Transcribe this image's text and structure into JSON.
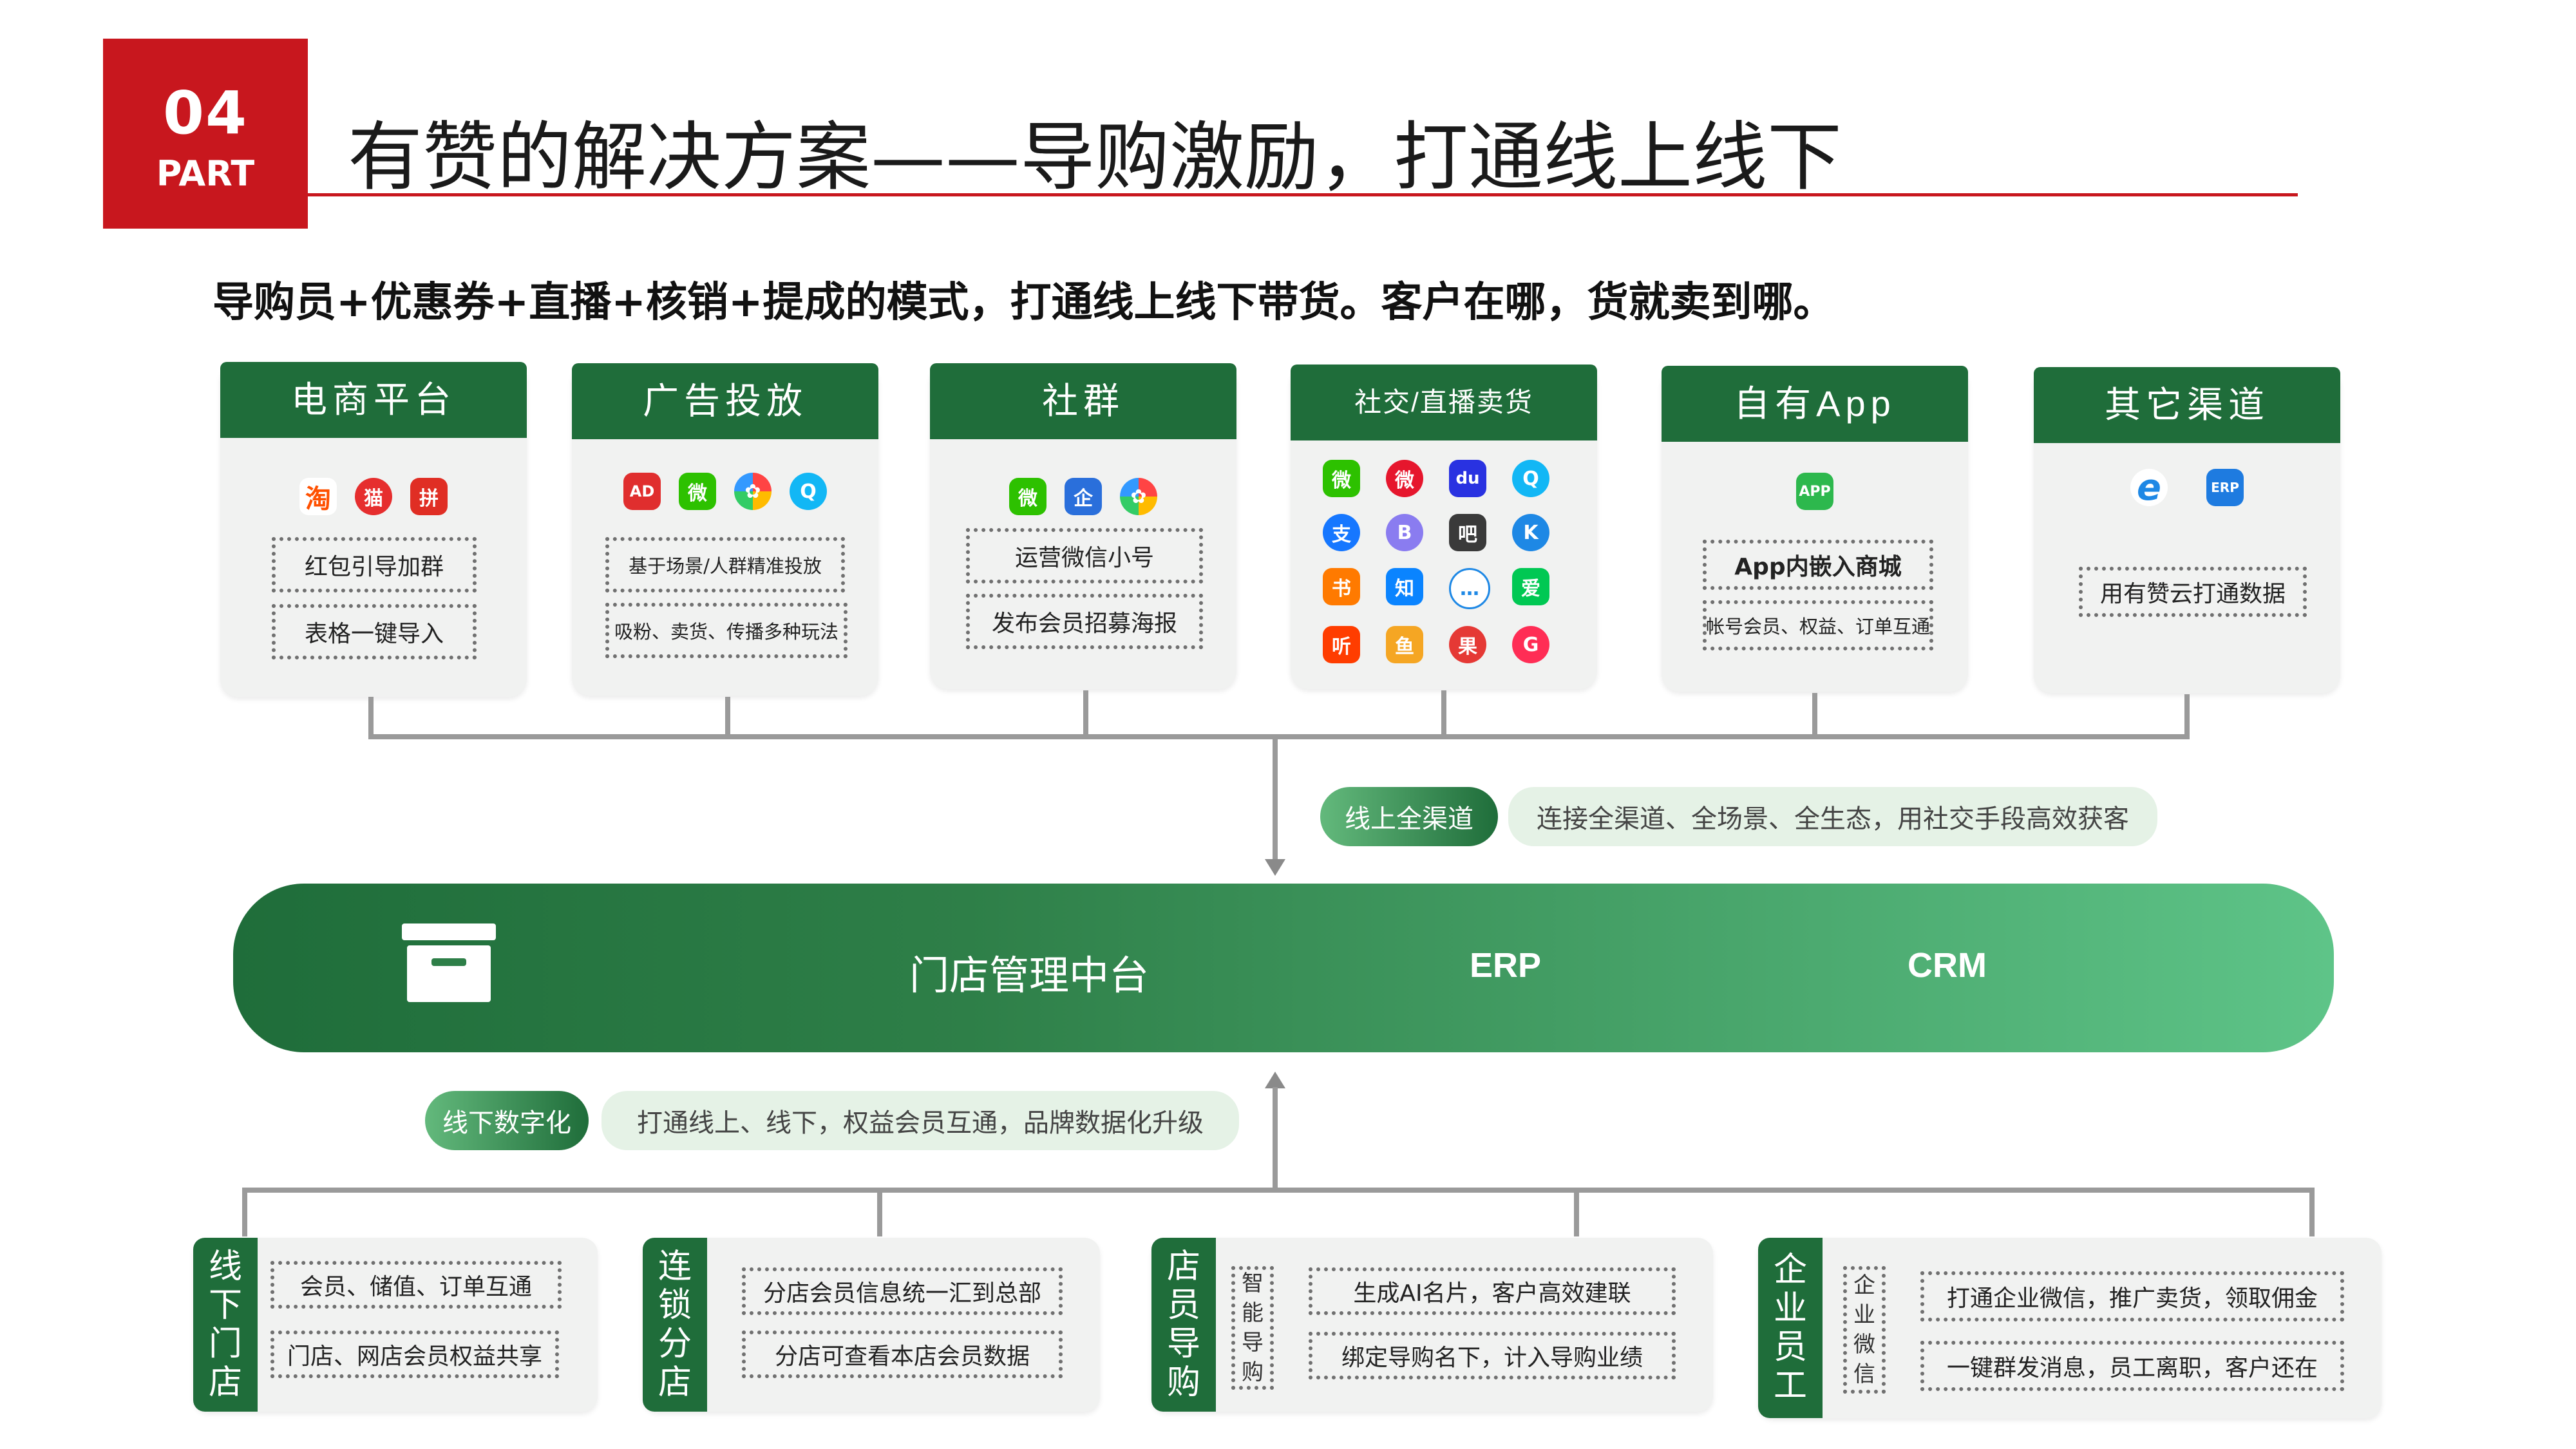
{
  "header": {
    "part_number": "04",
    "part_word": "PART",
    "title": "有赞的解决方案——导购激励，打通线上线下",
    "subtitle": "导购员+优惠券+直播+核销+提成的模式，打通线上线下带货。客户在哪，货就卖到哪。"
  },
  "channels": [
    {
      "title": "电商平台",
      "icons": [
        "taobao-icon",
        "tmall-icon",
        "pinduoduo-icon"
      ],
      "boxes": [
        "红包引导加群",
        "表格一键导入"
      ]
    },
    {
      "title": "广告投放",
      "icons": [
        "ad-icon",
        "wechat-icon",
        "photo-wheel-icon",
        "qq-icon"
      ],
      "boxes": [
        "基于场景/人群精准投放",
        "吸粉、卖货、传播多种玩法"
      ]
    },
    {
      "title": "社群",
      "icons": [
        "wechat-icon",
        "wecom-icon",
        "photo-wheel-icon"
      ],
      "boxes": [
        "运营微信小号",
        "发布会员招募海报"
      ]
    },
    {
      "title": "社交/直播卖货",
      "icons": [
        "wechat-icon",
        "weibo-icon",
        "baidu-icon",
        "qq-icon",
        "alipay-icon",
        "bilibili-icon",
        "tieba-icon",
        "kuaishou-icon",
        "xiaohongshu-icon",
        "zhihu-icon",
        "comment-icon",
        "iqiyi-icon",
        "ting-icon",
        "douyu-icon",
        "fruit-icon",
        "share-icon"
      ],
      "boxes": []
    },
    {
      "title": "自有App",
      "icons": [
        "app-icon"
      ],
      "boxes": [
        "App内嵌入商城",
        "帐号会员、权益、订单互通"
      ]
    },
    {
      "title": "其它渠道",
      "icons": [
        "ie-icon",
        "erp-icon"
      ],
      "boxes": [
        "用有赞云打通数据"
      ]
    }
  ],
  "icon_text": {
    "taobao": "淘",
    "tmall": "猫",
    "pdd": "拼",
    "ad": "AD",
    "wechat": "微",
    "photo": "✿",
    "qq": "Q",
    "wecom": "企",
    "weibo": "微",
    "baidu": "du",
    "alipay": "支",
    "bili": "B",
    "tieba": "吧",
    "kuaishou": "K",
    "xhs": "书",
    "zhihu": "知",
    "comment": "…",
    "iqiyi": "爱",
    "ting": "听",
    "douyu": "鱼",
    "fruit": "果",
    "share": "G",
    "app": "APP",
    "ie": "e",
    "erp": "ERP"
  },
  "online_tag": {
    "label": "线上全渠道",
    "desc": "连接全渠道、全场景、全生态，用社交手段高效获客"
  },
  "hub": {
    "title": "门店管理中台",
    "erp": "ERP",
    "crm": "CRM"
  },
  "offline_tag": {
    "label": "线下数字化",
    "desc": "打通线上、线下，权益会员互通，品牌数据化升级"
  },
  "offline": [
    {
      "label": [
        "线",
        "下",
        "门",
        "店"
      ],
      "sub": [],
      "boxes": [
        "会员、储值、订单互通",
        "门店、网店会员权益共享"
      ]
    },
    {
      "label": [
        "连",
        "锁",
        "分",
        "店"
      ],
      "sub": [],
      "boxes": [
        "分店会员信息统一汇到总部",
        "分店可查看本店会员数据"
      ]
    },
    {
      "label": [
        "店",
        "员",
        "导",
        "购"
      ],
      "sub": [
        "智",
        "能",
        "导",
        "购"
      ],
      "boxes": [
        "生成AI名片，客户高效建联",
        "绑定导购名下，计入导购业绩"
      ]
    },
    {
      "label": [
        "企",
        "业",
        "员",
        "工"
      ],
      "sub": [
        "企",
        "业",
        "微",
        "信"
      ],
      "boxes": [
        "打通企业微信，推广卖货，领取佣金",
        "一键群发消息，员工离职，客户还在"
      ]
    }
  ],
  "colors": {
    "red": "#c8171e",
    "green_dark": "#1f6d3a",
    "green_light": "#5ec488"
  }
}
